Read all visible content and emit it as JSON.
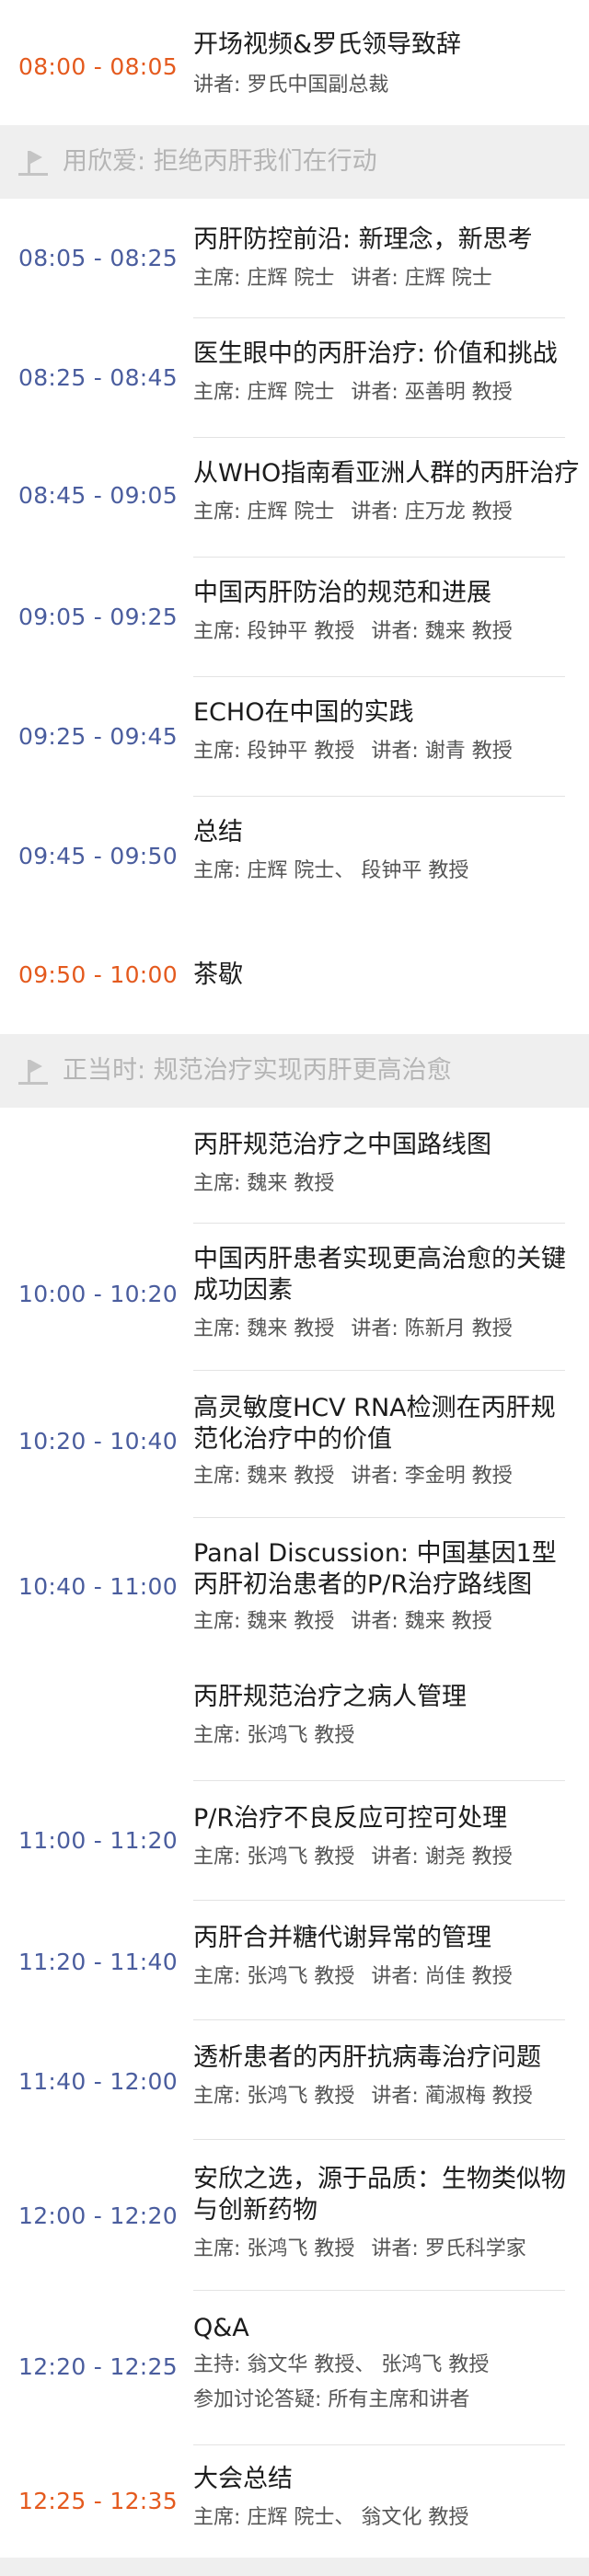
{
  "colors": {
    "time_blue": "#4a5d9e",
    "time_orange": "#e45a1e",
    "section_bg": "#efefef",
    "section_text": "#b5b5b5"
  },
  "items": {
    "opening": {
      "time": "08:00 - 08:05",
      "title": "开场视频&罗氏领导致辞",
      "speaker": "讲者: 罗氏中国副总裁"
    },
    "section1": {
      "icon": "flag-icon",
      "title": "用欣爱: 拒绝丙肝我们在行动"
    },
    "s1_1": {
      "time": "08:05 - 08:25",
      "title": "丙肝防控前沿: 新理念，新思考",
      "chair": "主席: 庄辉 院士",
      "speaker": "讲者: 庄辉 院士"
    },
    "s1_2": {
      "time": "08:25 - 08:45",
      "title": "医生眼中的丙肝治疗: 价值和挑战",
      "chair": "主席: 庄辉 院士",
      "speaker": "讲者: 巫善明 教授"
    },
    "s1_3": {
      "time": "08:45 - 09:05",
      "title": "从WHO指南看亚洲人群的丙肝治疗",
      "chair": "主席: 庄辉 院士",
      "speaker": "讲者: 庄万龙 教授"
    },
    "s1_4": {
      "time": "09:05 - 09:25",
      "title": "中国丙肝防治的规范和进展",
      "chair": "主席: 段钟平 教授",
      "speaker": "讲者: 魏来 教授"
    },
    "s1_5": {
      "time": "09:25 - 09:45",
      "title": "ECHO在中国的实践",
      "chair": "主席: 段钟平 教授",
      "speaker": "讲者: 谢青 教授"
    },
    "s1_6": {
      "time": "09:45 - 09:50",
      "title": "总结",
      "chair": "主席: 庄辉 院士、 段钟平 教授"
    },
    "tea": {
      "time": "09:50 - 10:00",
      "title": "茶歇"
    },
    "section2": {
      "icon": "flag-icon",
      "title": "正当时: 规范治疗实现丙肝更高治愈"
    },
    "s2_head": {
      "title": "丙肝规范治疗之中国路线图",
      "chair": "主席: 魏来 教授"
    },
    "s2_1": {
      "time": "10:00 - 10:20",
      "title": "中国丙肝患者实现更高治愈的关键成功因素",
      "chair": "主席: 魏来 教授",
      "speaker": "讲者: 陈新月 教授"
    },
    "s2_2": {
      "time": "10:20 - 10:40",
      "title": "高灵敏度HCV RNA检测在丙肝规范化治疗中的价值",
      "chair": "主席: 魏来 教授",
      "speaker": "讲者: 李金明 教授"
    },
    "s2_3": {
      "time": "10:40 - 11:00",
      "title": "Panal Discussion: 中国基因1型丙肝初治患者的P/R治疗路线图",
      "chair": "主席: 魏来 教授",
      "speaker": "讲者: 魏来 教授"
    },
    "s3_head": {
      "title": "丙肝规范治疗之病人管理",
      "chair": "主席: 张鸿飞 教授"
    },
    "s3_1": {
      "time": "11:00 - 11:20",
      "title": "P/R治疗不良反应可控可处理",
      "chair": "主席: 张鸿飞 教授",
      "speaker": "讲者: 谢尧 教授"
    },
    "s3_2": {
      "time": "11:20 - 11:40",
      "title": "丙肝合并糖代谢异常的管理",
      "chair": "主席: 张鸿飞 教授",
      "speaker": "讲者: 尚佳 教授"
    },
    "s3_3": {
      "time": "11:40 - 12:00",
      "title": "透析患者的丙肝抗病毒治疗问题",
      "chair": "主席: 张鸿飞 教授",
      "speaker": "讲者: 蔺淑梅 教授"
    },
    "s3_4": {
      "time": "12:00 - 12:20",
      "title": "安欣之选，源于品质：生物类似物与创新药物",
      "chair": "主席: 张鸿飞 教授",
      "speaker": "讲者: 罗氏科学家"
    },
    "qa": {
      "time": "12:20 - 12:25",
      "title": "Q&A",
      "chair": "主持: 翁文华 教授、 张鸿飞 教授",
      "note": "参加讨论答疑: 所有主席和讲者"
    },
    "closing": {
      "time": "12:25 - 12:35",
      "title": "大会总结",
      "chair": "主席: 庄辉 院士、 翁文化 教授"
    }
  }
}
